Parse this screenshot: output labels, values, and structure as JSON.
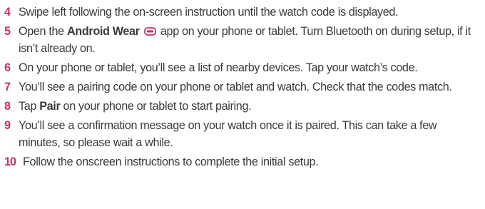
{
  "steps": [
    {
      "number": "4",
      "text": "Swipe left following the on-screen instruction until the watch code is displayed."
    },
    {
      "number": "5",
      "before": "Open the ",
      "bold": "Android Wear",
      "icon": "android-wear-app-icon",
      "after": " app on your phone or tablet. Turn Bluetooth on during setup, if it isn’t already on."
    },
    {
      "number": "6",
      "text": "On your phone or tablet, you’ll see a list of nearby devices. Tap your watch’s code."
    },
    {
      "number": "7",
      "text": "You’ll see a pairing code on your phone or tablet and watch. Check that the codes match."
    },
    {
      "number": "8",
      "before": "Tap ",
      "bold": "Pair",
      "after": " on your phone or tablet to start pairing."
    },
    {
      "number": "9",
      "text": "You’ll see a confirmation message on your watch once it is paired. This can take a few minutes, so please wait a while."
    },
    {
      "number": "10",
      "text": "Follow the onscreen instructions to complete the initial setup."
    }
  ],
  "colors": {
    "step_number": "#c8305d",
    "body_text": "#3a3a3a",
    "icon": "#c8305d"
  }
}
